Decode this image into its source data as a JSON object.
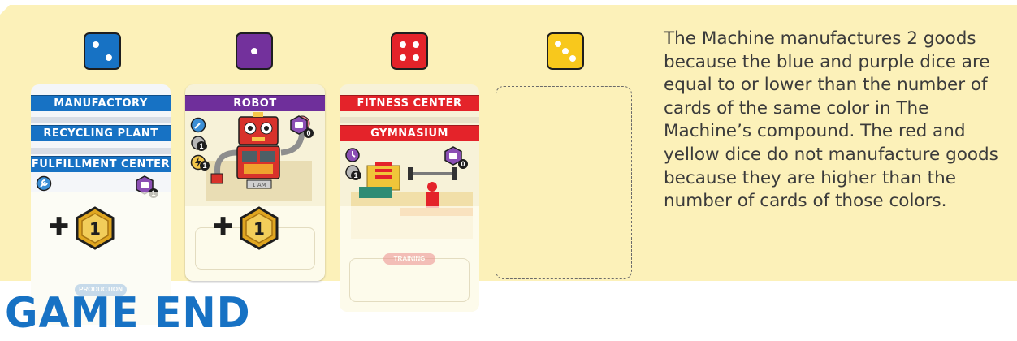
{
  "dice": [
    {
      "color": "blue",
      "fill": "#1772c4",
      "pips": 2
    },
    {
      "color": "purple",
      "fill": "#73319c",
      "pips": 1
    },
    {
      "color": "red",
      "fill": "#e4232a",
      "pips": 4
    },
    {
      "color": "yellow",
      "fill": "#f8c81c",
      "pips": 3
    }
  ],
  "cards": {
    "blue": [
      "MANUFACTORY",
      "RECYCLING PLANT",
      "FULFILLMENT CENTER"
    ],
    "purple": [
      "ROBOT"
    ],
    "red": [
      "FITNESS CENTER",
      "GYMNASIUM"
    ]
  },
  "card_numbers": {
    "zero": "0",
    "one": "1"
  },
  "robot_dial": "1 AM",
  "card_text": {
    "production": "PRODUCTION",
    "training": "TRAINING"
  },
  "goods_coin_value": "1",
  "description": "The Machine manufactures 2 goods because the blue and purple dice are equal to or lower than the number of cards of the same color in The Machine’s compound. The red and yellow dice do not manufacture goods because they are higher than the number of cards of those colors.",
  "section_heading": "GAME END",
  "colors": {
    "panel_bg": "#fcf1b9",
    "blue": "#1772c4",
    "purple": "#6f2f9b",
    "red": "#e4232a",
    "yellow": "#f8c81c",
    "coin_gold": "#e0a620"
  }
}
